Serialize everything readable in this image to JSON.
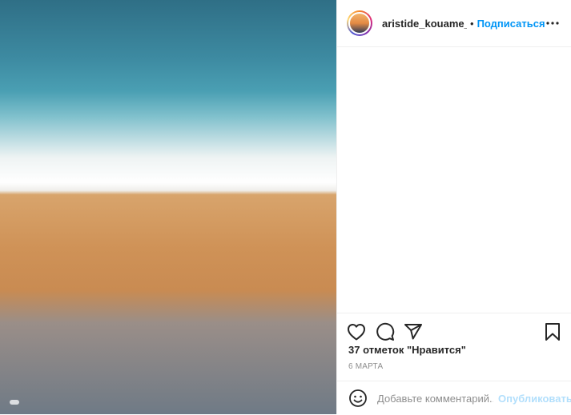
{
  "photo": {
    "alt": ""
  },
  "header": {
    "username": "aristide_kouame_pe",
    "separator": "•",
    "follow_label": "Подписаться",
    "more_icon": "more-horizontal-icon"
  },
  "actions": {
    "like_icon": "heart-icon",
    "comment_icon": "comment-icon",
    "share_icon": "share-icon",
    "save_icon": "bookmark-icon"
  },
  "likes_text": "37 отметок \"Нравится\"",
  "date_text": "6 марта",
  "comment": {
    "placeholder": "Добавьте комментарий...",
    "publish_label": "Опубликовать",
    "emoji_icon": "emoji-icon"
  },
  "colors": {
    "link_blue": "#0095f6",
    "publish_disabled": "#b2dffc",
    "text_primary": "#262626",
    "text_secondary": "#8e8e8e",
    "divider": "#efefef"
  }
}
